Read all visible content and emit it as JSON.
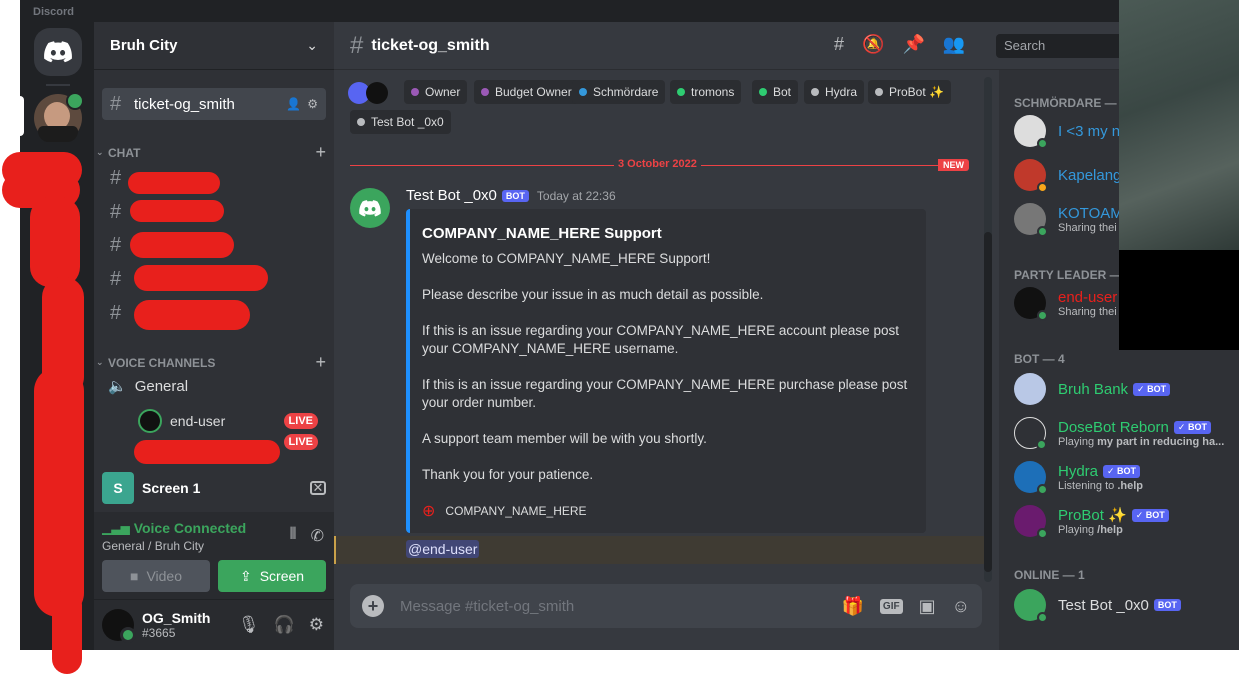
{
  "app": {
    "name": "Discord"
  },
  "server": {
    "name": "Bruh City"
  },
  "sidebar": {
    "active_channel": "ticket-og_smith",
    "chat_category": "CHAT",
    "voice_category": "VOICE CHANNELS",
    "voice_channel": "General",
    "voice_users": [
      {
        "name": "end-user",
        "live": "LIVE"
      },
      {
        "name": "",
        "live": "LIVE"
      }
    ],
    "screen_share": {
      "thumb": "S",
      "label": "Screen 1"
    }
  },
  "voice_panel": {
    "status": "Voice Connected",
    "location": "General / Bruh City",
    "video_label": "Video",
    "screen_label": "Screen"
  },
  "user_panel": {
    "name": "OG_Smith",
    "tag": "#3665"
  },
  "chat": {
    "channel": "ticket-og_smith",
    "search_placeholder": "Search",
    "roles": [
      {
        "name": "Owner",
        "color": "#9b59b6"
      },
      {
        "name": "Budget Owner",
        "color": "#9b59b6"
      },
      {
        "name": "Schmördare",
        "color": "#3498db"
      },
      {
        "name": "tromons",
        "color": "#2ecc71"
      },
      {
        "name": "Bot",
        "color": "#2ecc71"
      },
      {
        "name": "Hydra",
        "color": "#b9bbbe"
      },
      {
        "name": "ProBot ✨",
        "color": "#b9bbbe"
      },
      {
        "name": "Test Bot _0x0",
        "color": "#b9bbbe"
      }
    ],
    "divider_date": "3 October 2022",
    "new_label": "NEW",
    "message": {
      "author": "Test Bot _0x0",
      "bot_tag": "BOT",
      "time": "Today at 22:36",
      "embed": {
        "title": "COMPANY_NAME_HERE Support",
        "lines": [
          "Welcome to COMPANY_NAME_HERE Support!",
          "Please describe your issue in as much detail as possible.",
          "If this is an issue regarding your COMPANY_NAME_HERE account please post your COMPANY_NAME_HERE username.",
          "If this is an issue regarding your COMPANY_NAME_HERE purchase please post your order number.",
          "A support team member will be with you shortly.",
          "Thank you for your patience."
        ],
        "footer": "COMPANY_NAME_HERE"
      },
      "mention": "@end-user"
    },
    "composer_placeholder": "Message #ticket-og_smith",
    "gif_label": "GIF"
  },
  "members": {
    "sections": [
      {
        "title": "SCHMÖRDARE —"
      },
      {
        "title": "PARTY LEADER —"
      },
      {
        "title": "BOT — 4"
      },
      {
        "title": "ONLINE — 1"
      }
    ],
    "list": [
      {
        "name": "I <3 my n",
        "sub": "",
        "color": "#3498db"
      },
      {
        "name": "Kapelang",
        "sub": "",
        "color": "#3498db"
      },
      {
        "name": "KOTOAM",
        "sub": "Sharing thei",
        "color": "#3498db"
      },
      {
        "name": "end-user",
        "sub": "Sharing thei",
        "color": "#e8201c"
      },
      {
        "name": "Bruh Bank",
        "sub": "",
        "color": "#2ecc71",
        "bot": "✓ BOT"
      },
      {
        "name": "DoseBot Reborn",
        "sub_pre": "Playing ",
        "sub_bold": "my part in reducing ha...",
        "color": "#2ecc71",
        "bot": "✓ BOT"
      },
      {
        "name": "Hydra",
        "sub_pre": "Listening to ",
        "sub_bold": ".help",
        "color": "#2ecc71",
        "bot": "✓ BOT"
      },
      {
        "name": "ProBot ✨",
        "sub_pre": "Playing ",
        "sub_bold": "/help",
        "color": "#2ecc71",
        "bot": "✓ BOT"
      },
      {
        "name": "Test Bot _0x0",
        "sub": "",
        "color": "#dcddde",
        "bot": "BOT"
      }
    ]
  }
}
